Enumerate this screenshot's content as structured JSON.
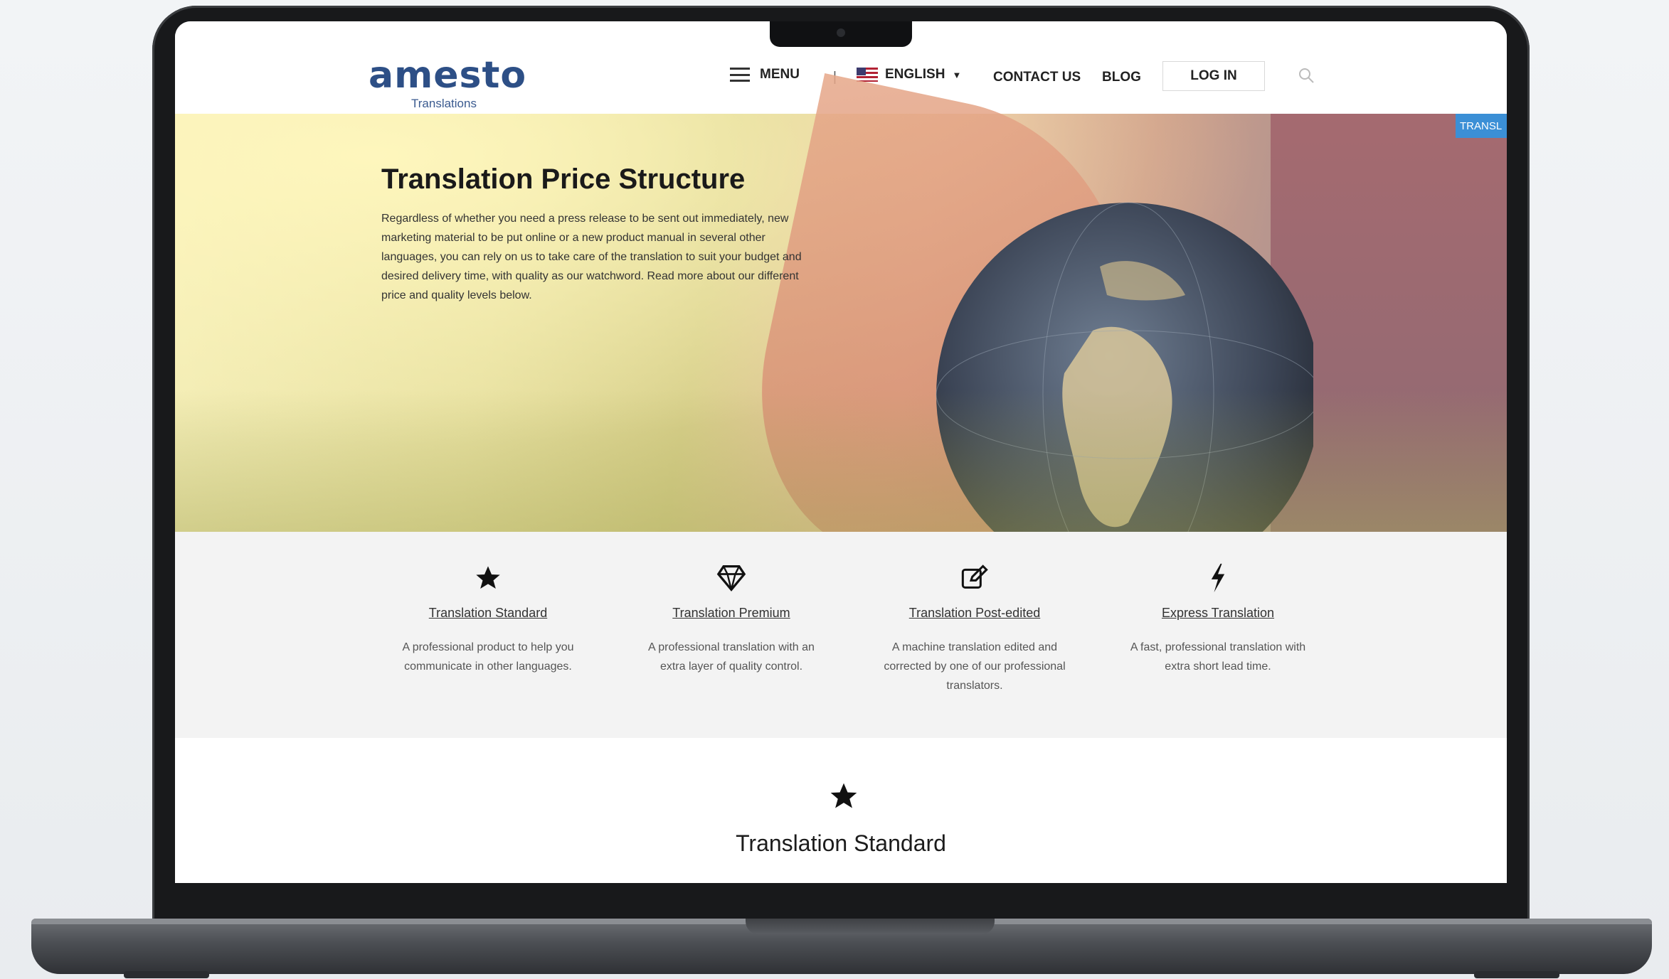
{
  "header": {
    "logo_text": "amesto",
    "logo_sub": "Translations",
    "menu_label": "MENU",
    "divider": "|",
    "language_label": "ENGLISH",
    "contact_label": "CONTACT US",
    "blog_label": "BLOG",
    "login_label": "LOG IN",
    "translate_tab": "TRANSL"
  },
  "hero": {
    "title": "Translation Price Structure",
    "intro": "Regardless of whether you need a press release to be sent out immediately, new marketing material to be put online or a new product manual in several other languages, you can rely on us to take care of the translation to suit your budget and desired delivery time, with quality as our watchword. Read more about our different price and quality levels below."
  },
  "features": [
    {
      "icon": "star-icon",
      "link": "Translation Standard",
      "desc": "A professional product to help you communicate in other languages."
    },
    {
      "icon": "diamond-icon",
      "link": "Translation Premium",
      "desc": "A professional translation with an extra layer of quality control."
    },
    {
      "icon": "edit-icon",
      "link": "Translation Post-edited",
      "desc": "A machine translation edited and corrected by one of our professional translators."
    },
    {
      "icon": "bolt-icon",
      "link": "Express Translation",
      "desc": "A fast, professional translation with extra short lead time."
    }
  ],
  "section": {
    "heading": "Translation Standard"
  },
  "colors": {
    "brand": "#2d4f86",
    "translate_tab": "#3b8fd6"
  }
}
